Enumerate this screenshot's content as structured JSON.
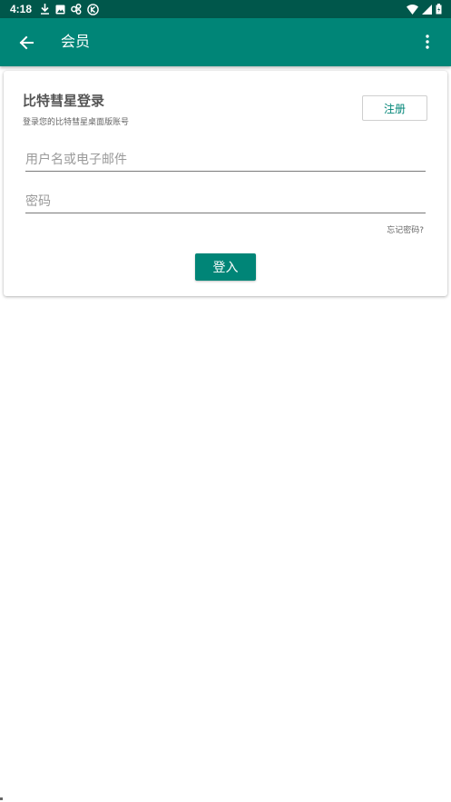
{
  "status_bar": {
    "time": "4:18",
    "background": "#00574B",
    "left_icons": [
      "download-icon",
      "photo-icon",
      "link-icon",
      "k-circle-icon"
    ],
    "right_icons": [
      "wifi-icon",
      "signal-icon",
      "battery-icon"
    ]
  },
  "app_bar": {
    "title": "会员",
    "background": "#008577",
    "back_icon": "arrow-left-icon",
    "menu_icon": "more-vert-icon"
  },
  "login_card": {
    "title": "比特彗星登录",
    "subtitle": "登录您的比特彗星桌面版账号",
    "register_label": "注册",
    "username_placeholder": "用户名或电子邮件",
    "username_value": "",
    "password_placeholder": "密码",
    "password_value": "",
    "forgot_label": "忘记密码?",
    "login_label": "登入",
    "accent": "#008577"
  }
}
